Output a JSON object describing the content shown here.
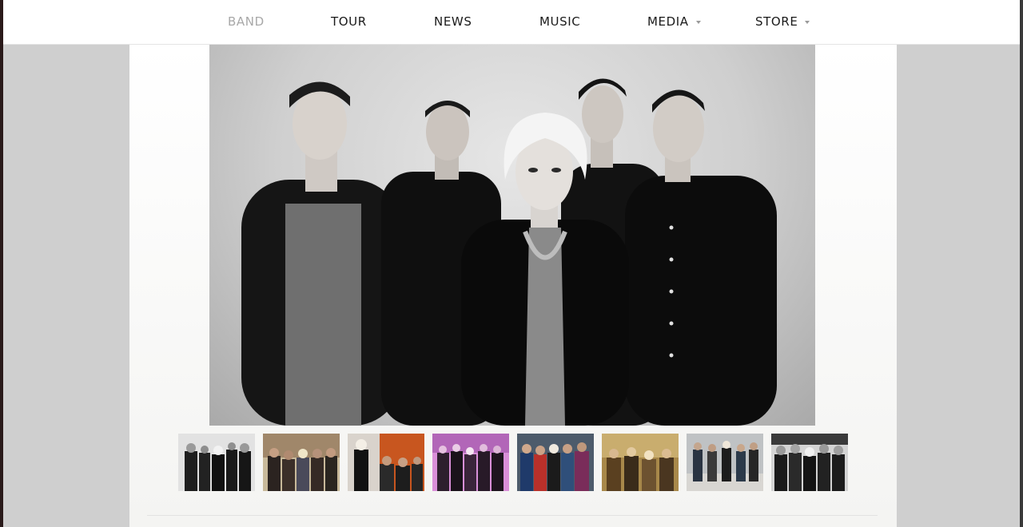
{
  "nav": {
    "items": [
      {
        "label": "BAND",
        "active": true,
        "has_dropdown": false
      },
      {
        "label": "TOUR",
        "active": false,
        "has_dropdown": false
      },
      {
        "label": "NEWS",
        "active": false,
        "has_dropdown": false
      },
      {
        "label": "MUSIC",
        "active": false,
        "has_dropdown": false
      },
      {
        "label": "MEDIA",
        "active": false,
        "has_dropdown": true
      },
      {
        "label": "STORE",
        "active": false,
        "has_dropdown": true
      }
    ]
  },
  "gallery": {
    "thumbnail_count": 8,
    "selected_index": 0
  },
  "colors": {
    "nav_text": "#1a1a1a",
    "nav_active": "#a8a8a8",
    "page_bg": "#cfcfcf",
    "content_bg": "#ffffff"
  }
}
